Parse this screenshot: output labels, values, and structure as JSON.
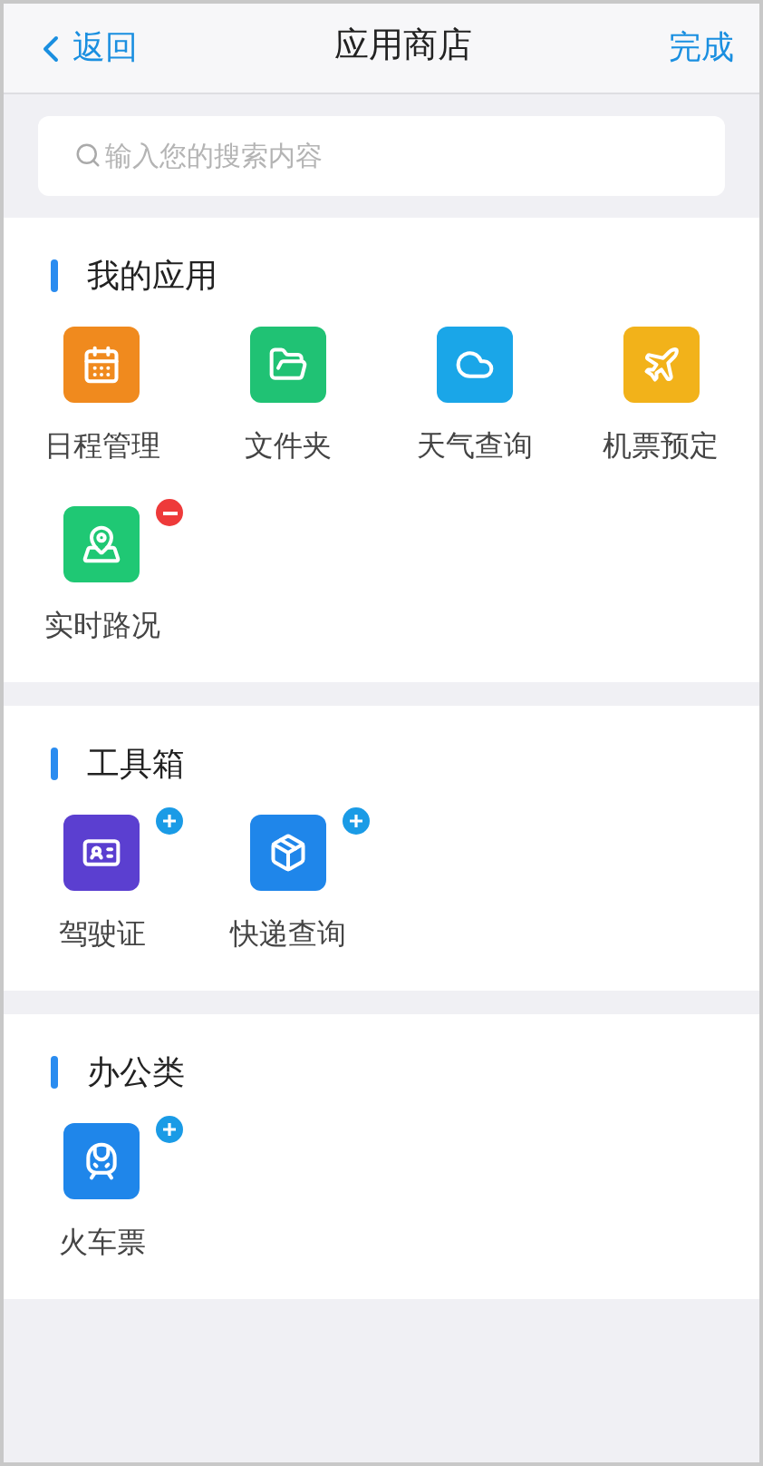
{
  "nav": {
    "back": "返回",
    "title": "应用商店",
    "done": "完成"
  },
  "search": {
    "placeholder": "输入您的搜索内容"
  },
  "sections": [
    {
      "title": "我的应用",
      "apps": [
        {
          "label": "日程管理",
          "kind": "calendar",
          "color": "#f08a1e"
        },
        {
          "label": "文件夹",
          "kind": "folder",
          "color": "#20c274"
        },
        {
          "label": "天气查询",
          "kind": "weather",
          "color": "#1aa6e8"
        },
        {
          "label": "机票预定",
          "kind": "plane",
          "color": "#f2b21a"
        },
        {
          "label": "实时路况",
          "kind": "map",
          "color": "#1fc874",
          "badge": {
            "kind": "remove"
          }
        }
      ]
    },
    {
      "title": "工具箱",
      "apps": [
        {
          "label": "驾驶证",
          "kind": "license",
          "color": "#5b3fd0",
          "badge": {
            "kind": "add"
          }
        },
        {
          "label": "快递查询",
          "kind": "parcel",
          "color": "#1f86ea",
          "badge": {
            "kind": "add"
          }
        }
      ]
    },
    {
      "title": "办公类",
      "apps": [
        {
          "label": "火车票",
          "kind": "train",
          "color": "#1f86ea",
          "badge": {
            "kind": "add"
          }
        }
      ]
    }
  ]
}
